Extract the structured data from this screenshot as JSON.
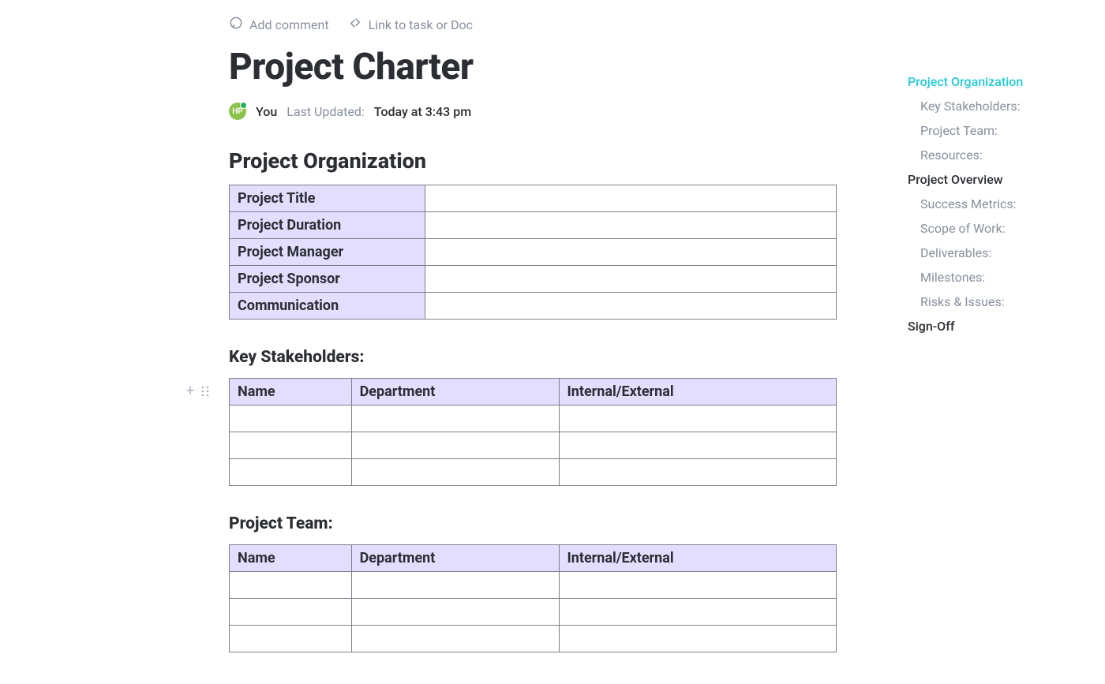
{
  "toolbar": {
    "add_comment": "Add comment",
    "link_task": "Link to task or Doc"
  },
  "doc": {
    "title": "Project Charter",
    "avatar_initials": "HP",
    "author": "You",
    "updated_label": "Last Updated:",
    "updated_time": "Today at 3:43 pm"
  },
  "organization": {
    "heading": "Project Organization",
    "rows": [
      {
        "label": "Project Title",
        "value": ""
      },
      {
        "label": "Project Duration",
        "value": ""
      },
      {
        "label": "Project Manager",
        "value": ""
      },
      {
        "label": "Project Sponsor",
        "value": ""
      },
      {
        "label": "Communication",
        "value": ""
      }
    ]
  },
  "stakeholders": {
    "heading": "Key Stakeholders:",
    "columns": [
      "Name",
      "Department",
      "Internal/External"
    ],
    "rows": 3
  },
  "team": {
    "heading": "Project Team:",
    "columns": [
      "Name",
      "Department",
      "Internal/External"
    ],
    "rows": 3
  },
  "outline": [
    {
      "label": "Project Organization",
      "level": 1,
      "active": true
    },
    {
      "label": "Key Stakeholders:",
      "level": 2,
      "active": false
    },
    {
      "label": "Project Team:",
      "level": 2,
      "active": false
    },
    {
      "label": "Resources:",
      "level": 2,
      "active": false
    },
    {
      "label": "Project Overview",
      "level": 1,
      "active": false
    },
    {
      "label": "Success Metrics:",
      "level": 2,
      "active": false
    },
    {
      "label": "Scope of Work:",
      "level": 2,
      "active": false
    },
    {
      "label": "Deliverables:",
      "level": 2,
      "active": false
    },
    {
      "label": "Milestones:",
      "level": 2,
      "active": false
    },
    {
      "label": "Risks & Issues:",
      "level": 2,
      "active": false
    },
    {
      "label": "Sign-Off",
      "level": 1,
      "active": false
    }
  ]
}
